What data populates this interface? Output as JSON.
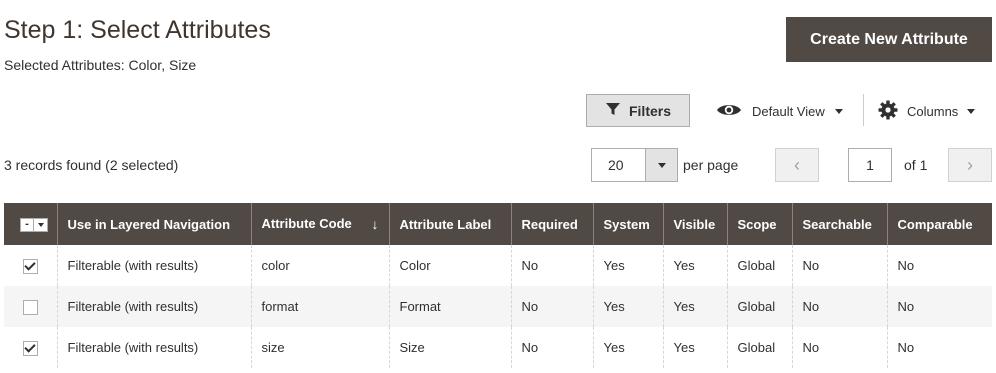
{
  "header": {
    "title": "Step 1: Select Attributes",
    "selected_line": "Selected Attributes: Color, Size",
    "create_button": "Create New Attribute"
  },
  "toolbar": {
    "filters_label": "Filters",
    "view_label": "Default View",
    "columns_label": "Columns"
  },
  "pager": {
    "records_text": "3 records found (2 selected)",
    "per_page_value": "20",
    "per_page_label": "per page",
    "prev_glyph": "‹",
    "next_glyph": "›",
    "current_page": "1",
    "of_text": "of 1"
  },
  "grid": {
    "mass_select_label": "-",
    "columns": [
      "Use in Layered Navigation",
      "Attribute Code",
      "Attribute Label",
      "Required",
      "System",
      "Visible",
      "Scope",
      "Searchable",
      "Comparable"
    ],
    "sorted_column": "Attribute Code",
    "sort_glyph": "↓",
    "rows": [
      {
        "checked": true,
        "cells": [
          "Filterable (with results)",
          "color",
          "Color",
          "No",
          "Yes",
          "Yes",
          "Global",
          "No",
          "No"
        ]
      },
      {
        "checked": false,
        "cells": [
          "Filterable (with results)",
          "format",
          "Format",
          "No",
          "Yes",
          "Yes",
          "Global",
          "No",
          "No"
        ]
      },
      {
        "checked": true,
        "cells": [
          "Filterable (with results)",
          "size",
          "Size",
          "No",
          "Yes",
          "Yes",
          "Global",
          "No",
          "No"
        ]
      }
    ]
  },
  "icons": {
    "filter": "filter-icon",
    "view": "eye-icon",
    "columns": "gear-icon",
    "caret": "caret-down-icon"
  },
  "colors": {
    "header_bg": "#514943",
    "button_bg": "#514943",
    "title_color": "#41362f",
    "alt_row_bg": "#f5f5f5"
  }
}
